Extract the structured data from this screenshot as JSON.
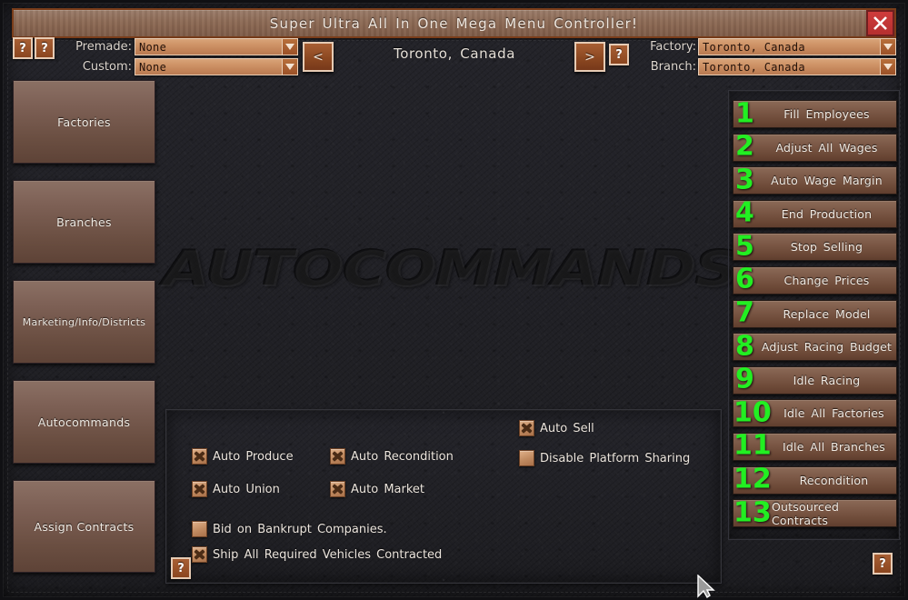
{
  "window": {
    "title": "Super Ultra All In One Mega Menu Controller!",
    "close_icon": "close-x-icon"
  },
  "toolbar": {
    "help_icon_label": "?",
    "premade": {
      "label": "Premade:",
      "value": "None"
    },
    "custom": {
      "label": "Custom:",
      "value": "None"
    },
    "prev_label": "<",
    "next_label": ">",
    "factory": {
      "label": "Factory:",
      "value": "Toronto, Canada"
    },
    "branch": {
      "label": "Branch:",
      "value": "Toronto, Canada"
    },
    "location_title": "Toronto, Canada"
  },
  "sidebar": {
    "items": [
      {
        "label": "Factories"
      },
      {
        "label": "Branches"
      },
      {
        "label": "Marketing/Info/Districts"
      },
      {
        "label": "Autocommands"
      },
      {
        "label": "Assign  Contracts"
      }
    ]
  },
  "watermark": {
    "text": "AUTOCOMMANDS"
  },
  "options": {
    "checkboxes": [
      {
        "label": "Auto  Produce",
        "checked": true
      },
      {
        "label": "Auto  Union",
        "checked": true
      },
      {
        "label": "Auto  Recondition",
        "checked": true
      },
      {
        "label": "Auto  Market",
        "checked": true
      },
      {
        "label": "Auto  Sell",
        "checked": true
      },
      {
        "label": "Disable  Platform  Sharing",
        "checked": false
      },
      {
        "label": "Bid  on  Bankrupt  Companies.",
        "checked": false
      },
      {
        "label": "Ship All  Required  Vehicles  Contracted",
        "checked": true
      }
    ]
  },
  "commands": {
    "accent_color": "#22ef22",
    "items": [
      {
        "number": "1",
        "label": "Fill  Employees"
      },
      {
        "number": "2",
        "label": "Adjust  All  Wages"
      },
      {
        "number": "3",
        "label": "Auto  Wage  Margin"
      },
      {
        "number": "4",
        "label": "End  Production"
      },
      {
        "number": "5",
        "label": "Stop  Selling"
      },
      {
        "number": "6",
        "label": "Change  Prices"
      },
      {
        "number": "7",
        "label": "Replace  Model"
      },
      {
        "number": "8",
        "label": "Adjust  Racing  Budget"
      },
      {
        "number": "9",
        "label": "Idle  Racing"
      },
      {
        "number": "10",
        "label": "Idle  All  Factories"
      },
      {
        "number": "11",
        "label": "Idle  All  Branches"
      },
      {
        "number": "12",
        "label": "Recondition"
      },
      {
        "number": "13",
        "label": "Outsourced  Contracts"
      }
    ]
  },
  "colors": {
    "background": "#24242a",
    "button_brown": "#7d5a48",
    "accent_green": "#22ef22",
    "close_red": "#cf3c3c",
    "combo_tan": "#cf9467"
  }
}
